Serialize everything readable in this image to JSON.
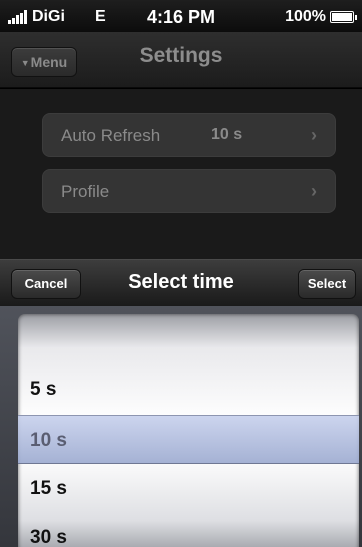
{
  "status_bar": {
    "carrier": "DiGi",
    "network": "E",
    "time": "4:16 PM",
    "battery": "100%"
  },
  "nav": {
    "menu_label": "Menu",
    "title": "Settings"
  },
  "settings_rows": [
    {
      "label": "Auto Refresh",
      "value": "10 s"
    },
    {
      "label": "Profile",
      "value": ""
    }
  ],
  "picker": {
    "cancel_label": "Cancel",
    "title": "Select time",
    "select_label": "Select",
    "options": [
      "5 s",
      "10 s",
      "15 s",
      "30 s"
    ],
    "selected": "10 s"
  },
  "icons": {
    "signal": "signal-bars-icon",
    "battery": "battery-icon",
    "menu_caret": "caret-down-icon",
    "chevron": "chevron-right-icon"
  }
}
